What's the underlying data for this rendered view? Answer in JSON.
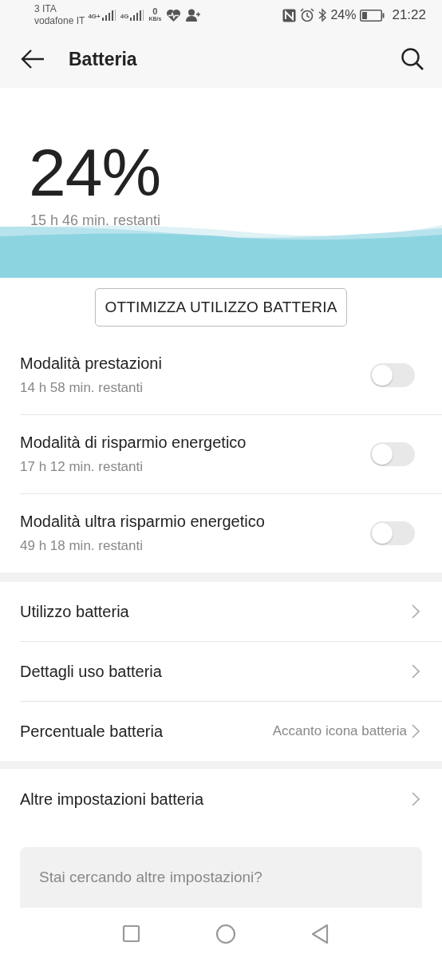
{
  "status_bar": {
    "carrier_1": "3 ITA",
    "carrier_2": "vodafone IT",
    "network_1": "4G+",
    "network_2": "4G",
    "data_rate": "0",
    "data_rate_unit": "KB/s",
    "battery": "24%",
    "time": "21:22"
  },
  "header": {
    "title": "Batteria"
  },
  "battery": {
    "percent": "24%",
    "remaining": "15 h 46 min. restanti"
  },
  "optimize_button": "OTTIMIZZA UTILIZZO BATTERIA",
  "modes": [
    {
      "label": "Modalità prestazioni",
      "remaining": "14 h 58 min. restanti",
      "on": false
    },
    {
      "label": "Modalità di risparmio energetico",
      "remaining": "17 h 12 min. restanti",
      "on": false
    },
    {
      "label": "Modalità ultra risparmio energetico",
      "remaining": "49 h 18 min. restanti",
      "on": false
    }
  ],
  "settings_groups": [
    [
      {
        "label": "Utilizzo batteria"
      },
      {
        "label": "Dettagli uso batteria"
      },
      {
        "label": "Percentuale batteria",
        "value": "Accanto icona batteria"
      }
    ],
    [
      {
        "label": "Altre impostazioni batteria"
      }
    ]
  ],
  "search": {
    "placeholder": "Stai cercando altre impostazioni?"
  }
}
